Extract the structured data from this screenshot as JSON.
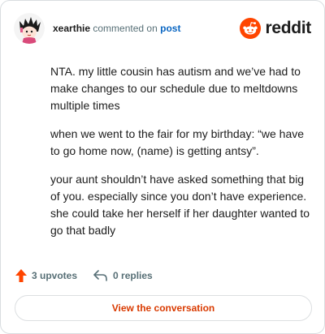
{
  "comment": {
    "author": "xearthie",
    "action": "commented on",
    "target": "post",
    "paragraphs": [
      "NTA. my little cousin has autism and we’ve had to make changes to our schedule due to meltdowns multiple times",
      "when we went to the fair for my birthday: “we have to go home now, (name) is getting antsy”.",
      "your aunt shouldn’t have asked something that big of you. especially since you don’t have experience. she could take her herself if her daughter wanted to go that badly"
    ]
  },
  "brand": {
    "name": "reddit",
    "icon": "reddit-logo-icon",
    "color": "#ff4500"
  },
  "stats": {
    "upvotes": "3 upvotes",
    "replies": "0 replies"
  },
  "actions": {
    "view_conversation": "View the conversation"
  },
  "colors": {
    "accent": "#d93a00",
    "upvote": "#ff4500",
    "link": "#0a66c2"
  }
}
